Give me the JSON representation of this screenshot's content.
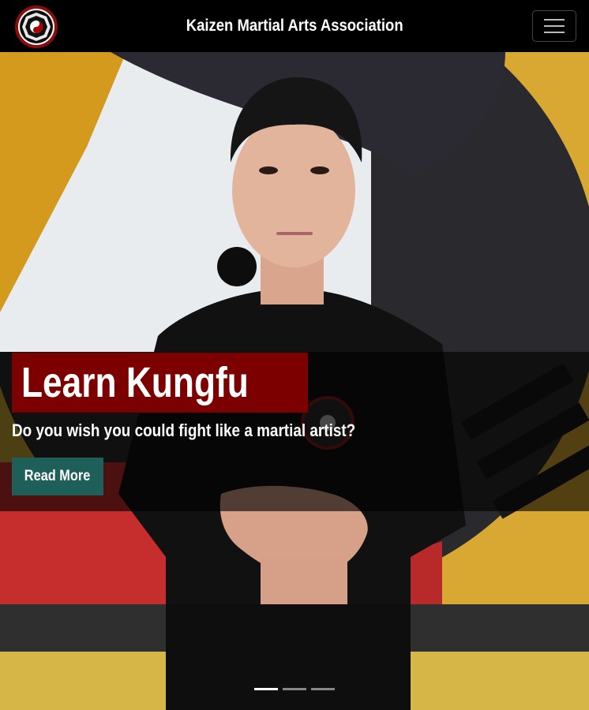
{
  "navbar": {
    "brand_title": "Kaizen Martial Arts Association",
    "logo_icon": "bagua-yin-yang-logo-icon",
    "toggle_icon": "hamburger-menu-icon"
  },
  "hero": {
    "headline": "Learn Kungfu",
    "subtitle": "Do you wish you could fight like a martial artist?",
    "cta_label": "Read More",
    "slide_count": 3,
    "active_slide": 1
  },
  "colors": {
    "navbar_bg": "#000000",
    "headline_bg": "#7d0000",
    "cta_bg": "#1f5f5a",
    "caption_overlay": "rgba(0,0,0,0.62)"
  }
}
